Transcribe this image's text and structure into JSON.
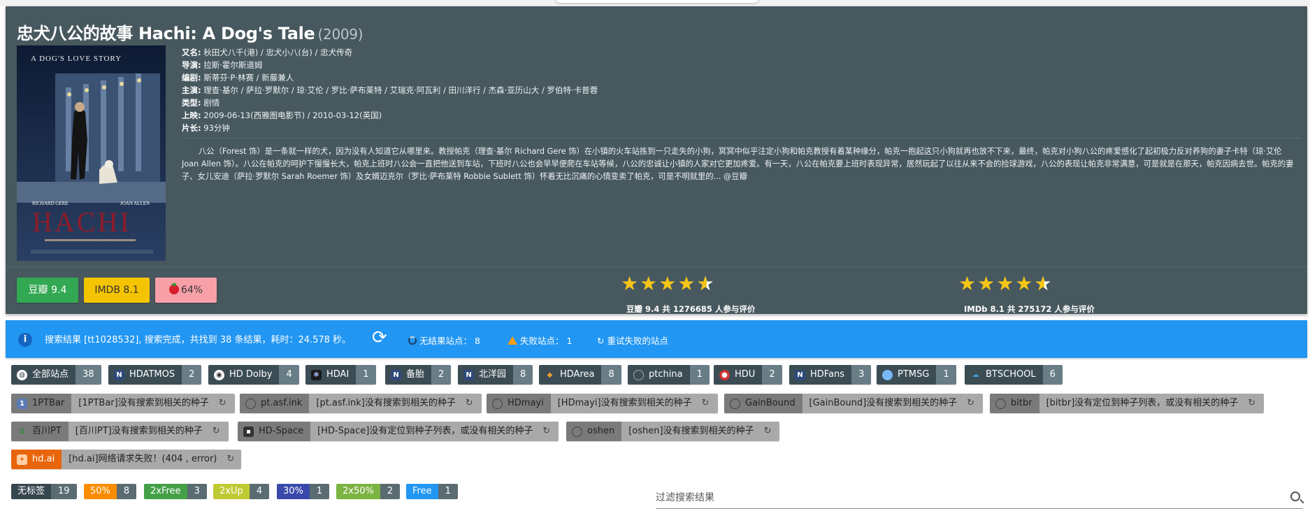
{
  "movie": {
    "title": "忠犬八公的故事 Hachi: A Dog's Tale",
    "year": "(2009)",
    "info": [
      {
        "k": "又名:",
        "v": "秋田犬八千(港) / 忠犬小八(台) / 忠犬传奇"
      },
      {
        "k": "导演:",
        "v": "拉斯·霍尔斯道姆"
      },
      {
        "k": "编剧:",
        "v": "斯蒂芬·P·林赛 / 新藤兼人"
      },
      {
        "k": "主演:",
        "v": "理查·基尔 / 萨拉·罗默尔 / 琼·艾伦 / 罗比·萨布莱特 / 艾瑞克·阿瓦利 / 田川洋行 / 杰森·亚历山大 / 罗伯特·卡普蓉"
      },
      {
        "k": "类型:",
        "v": "剧情"
      },
      {
        "k": "上映:",
        "v": "2009-06-13(西雅图电影节) / 2010-03-12(英国)"
      },
      {
        "k": "片长:",
        "v": "93分钟"
      }
    ],
    "summary": "八公（Forest 饰）是一条就一样的犬，因为没有人知道它从哪里来。教授帕克（理查·基尔 Richard Gere 饰）在小镇的火车站拣到一只走失的小狗，冥冥中似乎注定小狗和帕克教授有着某种缘分，帕克一抱起这只小狗就再也放不下来，最终，帕克对小狗八公的疼爱感化了起初极力反对养狗的妻子卡特（琼·艾伦 Joan Allen 饰）。八公在帕克的呵护下慢慢长大，帕克上班时八公会一直把他送到车站，下班时八公也会早早便爬在车站等候，八公的忠诚让小镇的人家对它更加疼爱。有一天，八公在帕克要上班时表现异常，居然玩起了以往从来不会的捡球游戏，八公的表现让帕克非常满意，可是就是在那天，帕克因病去世。帕克的妻子、女儿安迪（萨拉·罗默尔 Sarah Roemer 饰）及女婿迈克尔（罗比·萨布莱特 Robbie Sublett 饰）怀着无比沉痛的心情变卖了帕克，可是不明就里的... @豆瓣",
    "poster": {
      "tagline": "A DOG'S LOVE STORY",
      "name": "HACHI",
      "actor1": "RICHARD GERE",
      "actor2": "JOAN ALLEN"
    }
  },
  "ratings": {
    "douban_btn": "豆瓣 9.4",
    "imdb_btn": "IMDB 8.1",
    "tomato_btn": "64%",
    "douban_stars_value": 4.5,
    "douban_label": "豆瓣 9.4 共 1276685 人参与评价",
    "imdb_stars_value": 4.5,
    "imdb_label": "IMDb 8.1 共 275172 人参与评价",
    "star_color": "#f5c518"
  },
  "status": {
    "message": "搜索结果 [tt1028532], 搜索完成，共找到 38 条结果，耗时：24.578 秒。",
    "no_result": "无结果站点：  8",
    "failed": "失败站点：  1",
    "retry": "重试失败的站点",
    "bg_color": "#2196f3"
  },
  "sites": [
    {
      "name": "全部站点",
      "count": "38",
      "icon": "globe-icon"
    },
    {
      "name": "HDATMOS",
      "count": "2",
      "icon": "n-icon"
    },
    {
      "name": "HD Dolby",
      "count": "4",
      "icon": "dolby-icon"
    },
    {
      "name": "HDAI",
      "count": "1",
      "icon": "hdai-icon"
    },
    {
      "name": "备胎",
      "count": "2",
      "icon": "n-icon"
    },
    {
      "name": "北洋园",
      "count": "8",
      "icon": "n-icon"
    },
    {
      "name": "HDArea",
      "count": "8",
      "icon": "hdarea-icon"
    },
    {
      "name": "ptchina",
      "count": "1",
      "icon": "ptchina-icon"
    },
    {
      "name": "HDU",
      "count": "2",
      "icon": "hdu-icon"
    },
    {
      "name": "HDFans",
      "count": "3",
      "icon": "n-icon"
    },
    {
      "name": "PTMSG",
      "count": "1",
      "icon": "ptmsg-icon"
    },
    {
      "name": "BTSCHOOL",
      "count": "6",
      "icon": "btschool-icon"
    }
  ],
  "failed_sites": [
    {
      "name": "1PTBar",
      "msg": "[1PTBar]没有搜索到相关的种子"
    },
    {
      "name": "pt.asf.ink",
      "msg": "[pt.asf.ink]没有搜索到相关的种子"
    },
    {
      "name": "HDmayi",
      "msg": "[HDmayi]没有搜索到相关的种子"
    },
    {
      "name": "GainBound",
      "msg": "[GainBound]没有搜索到相关的种子"
    },
    {
      "name": "bitbr",
      "msg": "[bitbr]没有定位到种子列表，或没有相关的种子"
    },
    {
      "name": "百川PT",
      "msg": "[百川PT]没有搜索到相关的种子"
    },
    {
      "name": "HD-Space",
      "msg": "[HD-Space]没有定位到种子列表，或没有相关的种子"
    },
    {
      "name": "oshen",
      "msg": "[oshen]没有搜索到相关的种子"
    }
  ],
  "error_site": {
    "name": "hd.ai",
    "msg": "[hd.ai]网络请求失败！(404 , error)"
  },
  "labels": [
    {
      "name": "无标签",
      "count": "19",
      "color": "#37474f"
    },
    {
      "name": "50%",
      "count": "8",
      "color": "#fb8c00"
    },
    {
      "name": "2xFree",
      "count": "3",
      "color": "#43a047"
    },
    {
      "name": "2xUp",
      "count": "4",
      "color": "#c0ca33"
    },
    {
      "name": "30%",
      "count": "1",
      "color": "#3949ab"
    },
    {
      "name": "2x50%",
      "count": "2",
      "color": "#7cb342"
    },
    {
      "name": "Free",
      "count": "1",
      "color": "#2196f3"
    }
  ],
  "filter": {
    "placeholder": "过滤搜索结果"
  }
}
